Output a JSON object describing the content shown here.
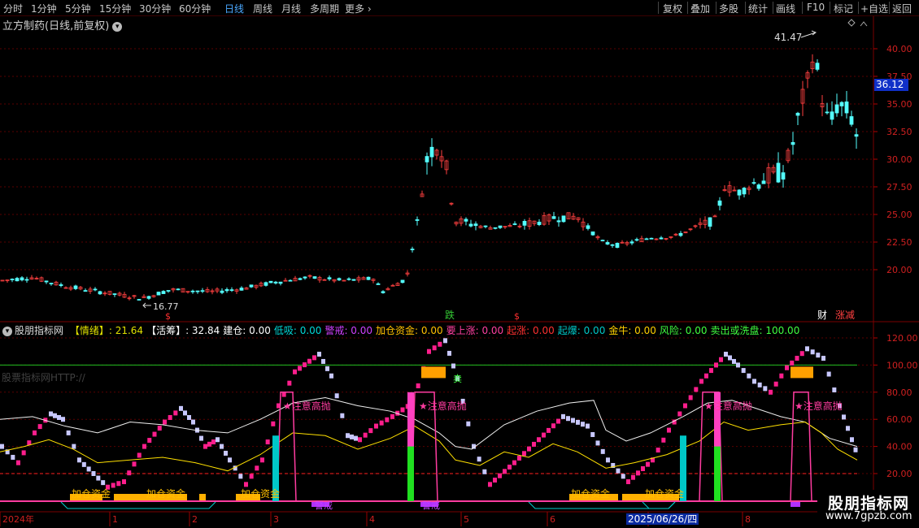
{
  "toolbar": {
    "timeframes": [
      "分时",
      "1分钟",
      "5分钟",
      "15分钟",
      "30分钟",
      "60分钟",
      "日线",
      "周线",
      "月线",
      "多周期",
      "更多"
    ],
    "active": "日线",
    "right_buttons": [
      "复权",
      "叠加",
      "多股",
      "统计",
      "画线",
      "F10",
      "标记",
      "+自选",
      "返回"
    ]
  },
  "stock": {
    "title": "立方制药(日线,前复权)",
    "high_label": "41.47",
    "low_label": "16.77",
    "current_price": "36.12",
    "price_axis": [
      "40.00",
      "37.50",
      "35.00",
      "32.50",
      "30.00",
      "27.50",
      "25.00",
      "22.50",
      "20.00"
    ],
    "signal_labels": {
      "die": "跌",
      "die_color": "#34c834",
      "small_mark": "$",
      "caijing": "财",
      "zhang_jian": "涨减"
    }
  },
  "indicator": {
    "name": "股朋指标网",
    "items": [
      {
        "label": "【情绪】: 21.64",
        "color": "#e0e000"
      },
      {
        "label": "【活筹】: 32.84",
        "color": "#ffffff"
      },
      {
        "label": "建仓: 0.00",
        "color": "#ffffff"
      },
      {
        "label": "低吸: 0.00",
        "color": "#00d8d8"
      },
      {
        "label": "警戒: 0.00",
        "color": "#d040ff"
      },
      {
        "label": "加仓资金: 0.00",
        "color": "#ffc000"
      },
      {
        "label": "要上涨: 0.00",
        "color": "#ff40a0"
      },
      {
        "label": "起涨: 0.00",
        "color": "#ff3030"
      },
      {
        "label": "起爆: 0.00",
        "color": "#00c8c8"
      },
      {
        "label": "金牛: 0.00",
        "color": "#ffd000"
      },
      {
        "label": "风险: 0.00",
        "color": "#40ff40"
      },
      {
        "label": "卖出或洗盘: 100.00",
        "color": "#40ff40"
      }
    ],
    "axis": [
      "120.00",
      "100.00",
      "80.00",
      "60.00",
      "40.00",
      "20.00"
    ],
    "watermark": "股票指标网HTTP://",
    "annotations": {
      "attention": "★注意高抛",
      "add_funds": "加仓资金",
      "warning": "警戒",
      "sell": "卖"
    }
  },
  "time_axis": [
    "2024年",
    "1",
    "2",
    "3",
    "4",
    "5",
    "6",
    "7",
    "8"
  ],
  "crosshair_date": "2025/06/26/四",
  "logo": {
    "name": "股朋指标网",
    "url": "www.7gpzb.com"
  }
}
